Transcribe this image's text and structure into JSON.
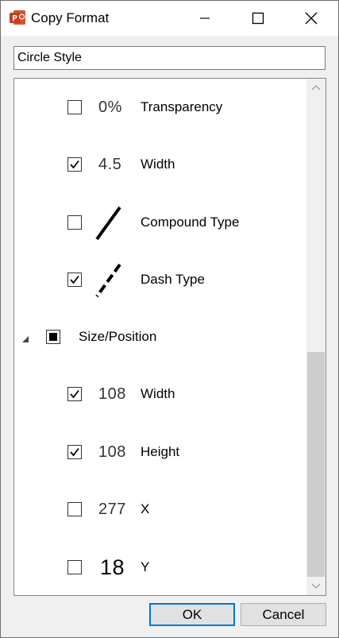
{
  "window": {
    "title": "Copy Format",
    "icon": "powerpoint-icon"
  },
  "name_field": {
    "value": "Circle Style"
  },
  "list": {
    "items": [
      {
        "kind": "option",
        "checked": false,
        "preview": "0%",
        "preview_type": "text",
        "label": "Transparency"
      },
      {
        "kind": "option",
        "checked": true,
        "preview": "4.5",
        "preview_type": "text",
        "label": "Width"
      },
      {
        "kind": "option",
        "checked": false,
        "preview": "",
        "preview_type": "compound-line-icon",
        "label": "Compound Type"
      },
      {
        "kind": "option",
        "checked": true,
        "preview": "",
        "preview_type": "dash-line-icon",
        "label": "Dash Type"
      },
      {
        "kind": "group",
        "expanded": true,
        "checked": "partial",
        "label": "Size/Position"
      },
      {
        "kind": "option",
        "checked": true,
        "preview": "108",
        "preview_type": "text",
        "label": "Width"
      },
      {
        "kind": "option",
        "checked": true,
        "preview": "108",
        "preview_type": "text",
        "label": "Height"
      },
      {
        "kind": "option",
        "checked": false,
        "preview": "277",
        "preview_type": "text",
        "label": "X"
      },
      {
        "kind": "option",
        "checked": false,
        "preview": "18",
        "preview_type": "text-large",
        "label": "Y"
      }
    ]
  },
  "buttons": {
    "ok_label": "OK",
    "cancel_label": "Cancel"
  },
  "colors": {
    "accent": "#0078d7",
    "app_icon": "#d24726"
  }
}
